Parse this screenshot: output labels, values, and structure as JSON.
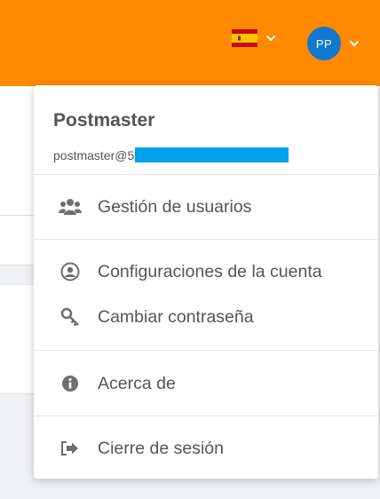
{
  "header": {
    "language": "Español",
    "avatar_initials": "PP",
    "colors": {
      "bar": "#ff8a00",
      "avatar": "#1177d1"
    }
  },
  "user_menu": {
    "name": "Postmaster",
    "email_prefix": "postmaster@5",
    "items": [
      {
        "label": "Gestión de usuarios",
        "icon": "users-icon"
      },
      {
        "label": "Configuraciones de la cuenta",
        "icon": "account-icon"
      },
      {
        "label": "Cambiar contraseña",
        "icon": "key-icon"
      },
      {
        "label": "Acerca de",
        "icon": "info-icon"
      },
      {
        "label": "Cierre de sesión",
        "icon": "logout-icon"
      }
    ]
  }
}
